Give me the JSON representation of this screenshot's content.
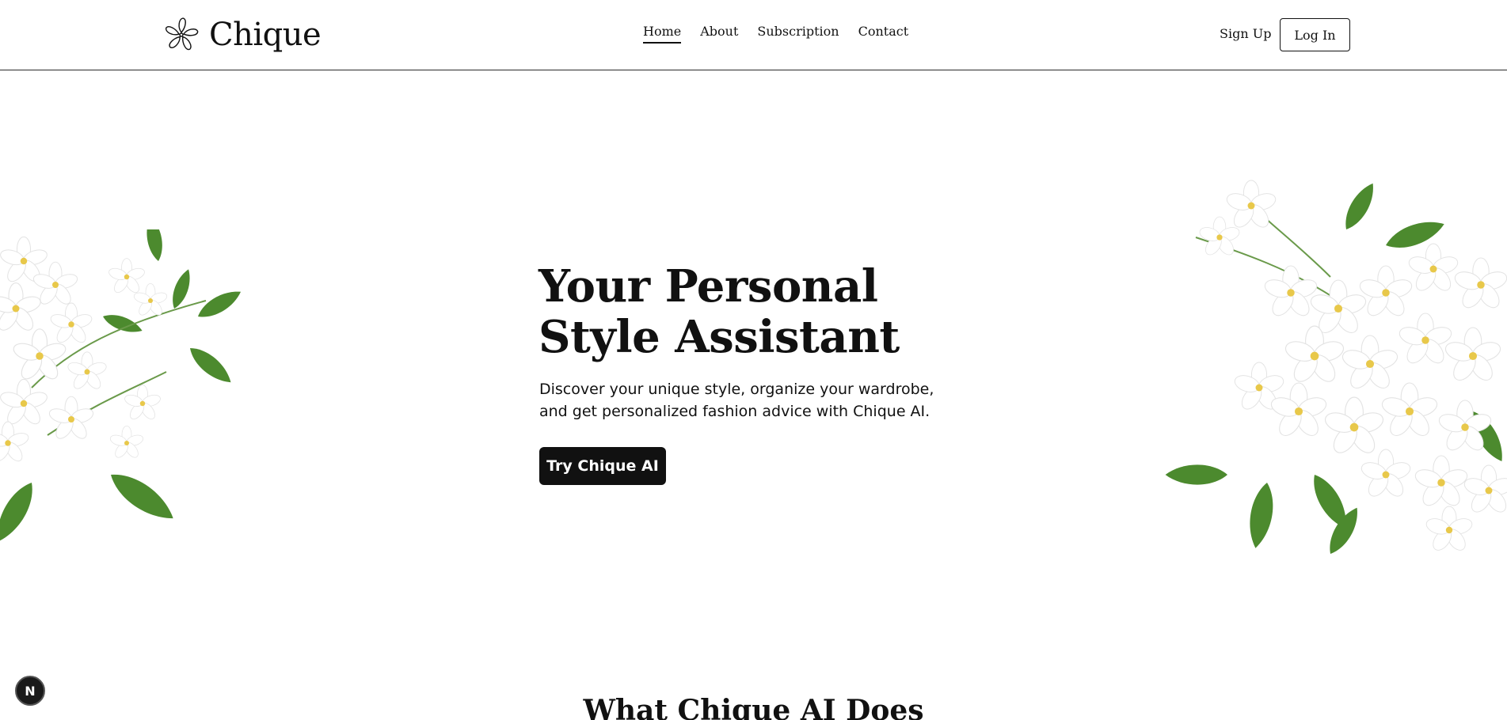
{
  "brand": {
    "name": "Chique"
  },
  "nav": {
    "items": [
      {
        "label": "Home",
        "active": true
      },
      {
        "label": "About",
        "active": false
      },
      {
        "label": "Subscription",
        "active": false
      },
      {
        "label": "Contact",
        "active": false
      }
    ]
  },
  "auth": {
    "signup_label": "Sign Up",
    "login_label": "Log In"
  },
  "hero": {
    "title": "Your Personal Style Assistant",
    "description": "Discover your unique style, organize your wardrobe, and get personalized fashion advice with Chique AI.",
    "cta_label": "Try Chique AI"
  },
  "section": {
    "title": "What Chique AI Does"
  },
  "dev_badge": {
    "label": "N"
  },
  "colors": {
    "text": "#111111",
    "background": "#ffffff",
    "button": "#111111",
    "leaf": "#4c8a2e",
    "flower": "#ffffff"
  }
}
